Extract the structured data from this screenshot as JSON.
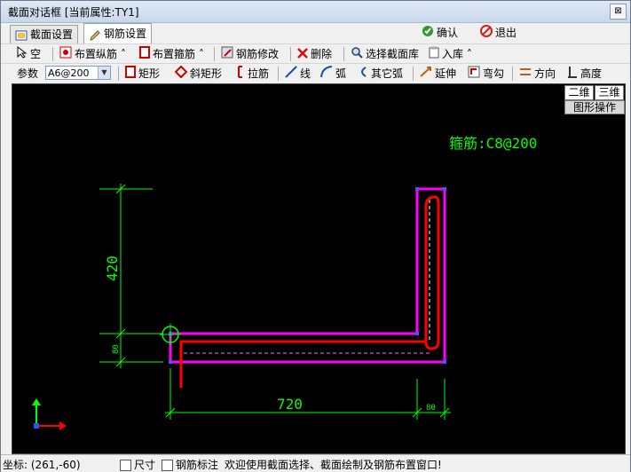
{
  "window": {
    "title": "截面对话框 [当前属性:TY1]",
    "close_label": "⊠"
  },
  "tabs": [
    {
      "label": "截面设置"
    },
    {
      "label": "钢筋设置"
    }
  ],
  "actions": {
    "confirm": "确认",
    "exit": "退出"
  },
  "toolbar1": {
    "empty": "空",
    "longitudinal": "布置纵筋",
    "stirrup": "布置箍筋",
    "modify": "钢筋修改",
    "delete": "删除",
    "library": "选择截面库",
    "import": "入库"
  },
  "toolbar2": {
    "param_label": "参数",
    "param_value": "A6@200",
    "rect": "矩形",
    "slant_rect": "斜矩形",
    "tie": "拉筋",
    "line": "线",
    "arc": "弧",
    "other_arc": "其它弧",
    "extend": "延伸",
    "hook": "弯勾",
    "direction": "方向",
    "height": "高度"
  },
  "view": {
    "btn_2d": "二维",
    "btn_3d": "三维",
    "ops": "图形操作"
  },
  "drawing": {
    "stirrup_label": "箍筋:C8@200",
    "dim_420": "420",
    "dim_80_left": "80",
    "dim_720": "720",
    "dim_80_right": "80"
  },
  "statusbar": {
    "coord": "坐标: (261,-60)",
    "size_label": "尺寸",
    "rebar_label": "钢筋标注",
    "message": "欢迎使用截面选择、截面绘制及钢筋布置窗口!"
  },
  "colors": {
    "section_outline": "#ff00ff",
    "rebar": "#ff0000",
    "dimension": "#00ff00",
    "canvas_bg": "#000000"
  }
}
